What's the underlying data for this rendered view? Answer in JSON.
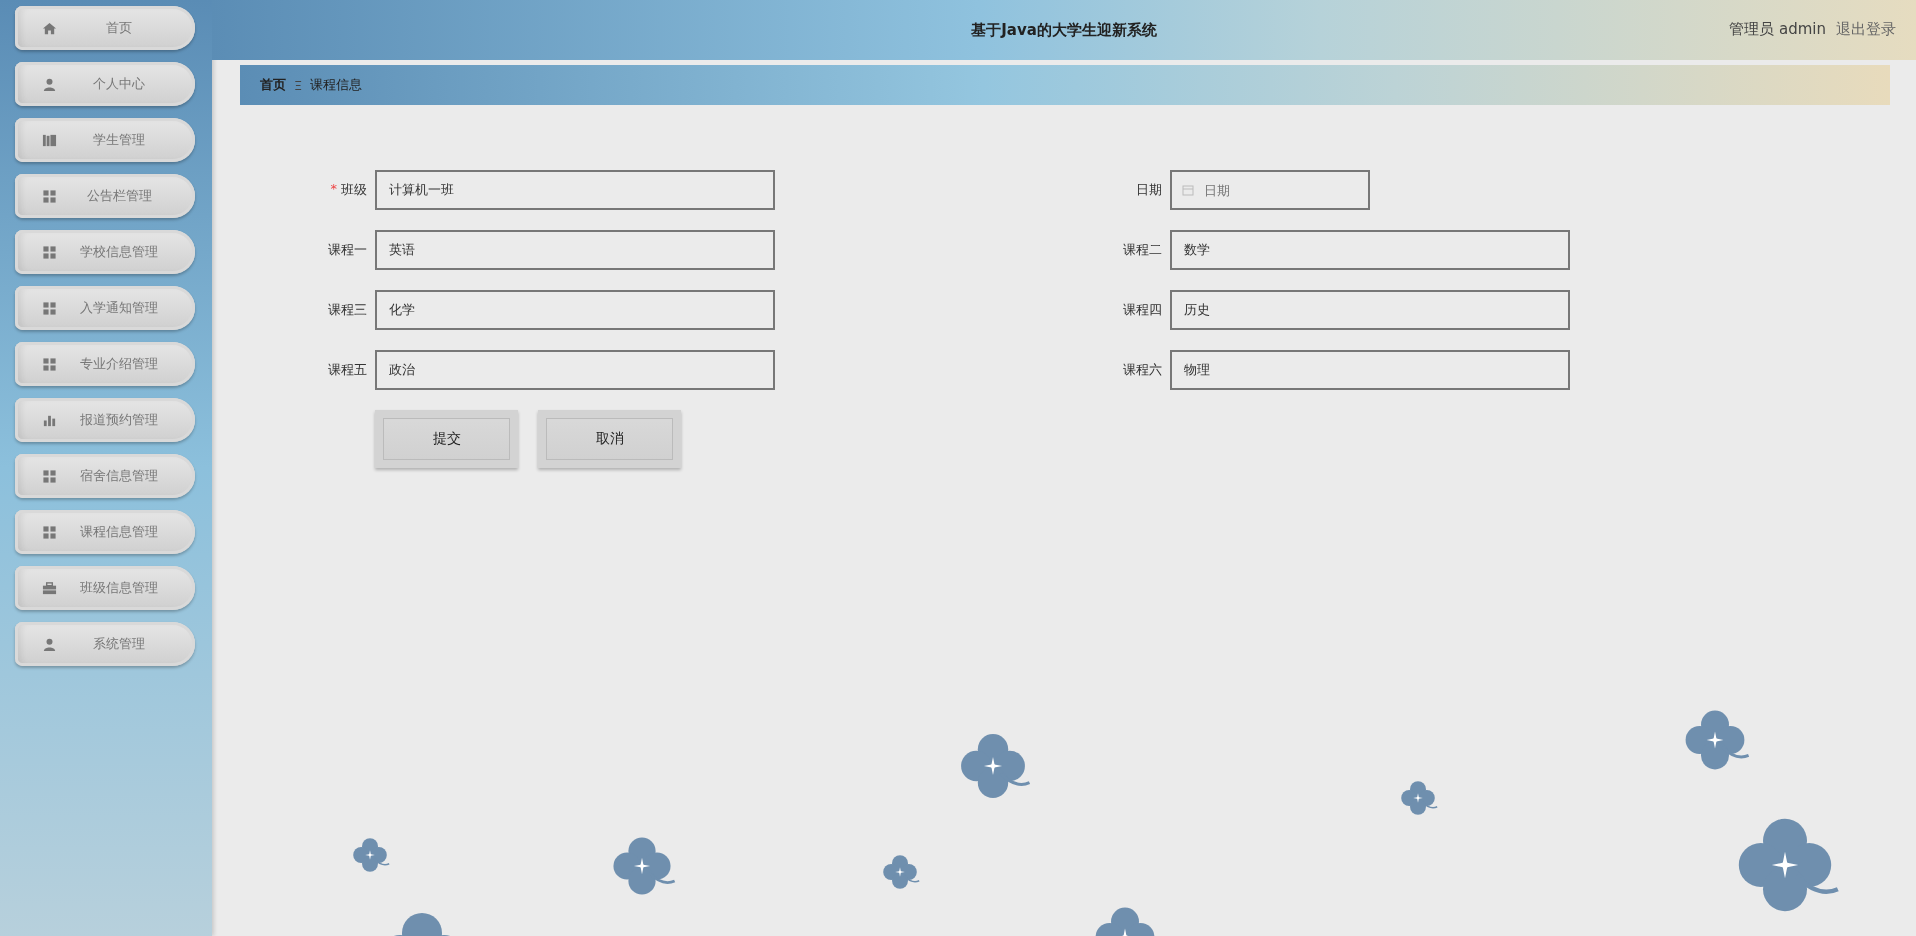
{
  "sidebar": {
    "items": [
      {
        "label": "首页",
        "selected": false
      },
      {
        "label": "个人中心",
        "selected": false
      },
      {
        "label": "学生管理",
        "selected": false
      },
      {
        "label": "公告栏管理",
        "selected": false
      },
      {
        "label": "学校信息管理",
        "selected": false
      },
      {
        "label": "入学通知管理",
        "selected": false
      },
      {
        "label": "专业介绍管理",
        "selected": false
      },
      {
        "label": "报道预约管理",
        "selected": false
      },
      {
        "label": "宿舍信息管理",
        "selected": false
      },
      {
        "label": "课程信息管理",
        "selected": false
      },
      {
        "label": "班级信息管理",
        "selected": false
      },
      {
        "label": "系统管理",
        "selected": false
      }
    ]
  },
  "header": {
    "title": "基于Java的大学生迎新系统",
    "user": "管理员 admin",
    "logout": "退出登录"
  },
  "breadcrumb": {
    "items": [
      "首页",
      "课程信息"
    ],
    "separator": "Ξ"
  },
  "form": {
    "left": [
      {
        "label": "班级",
        "required_mark": "*",
        "value": "计算机一班"
      },
      {
        "label": "课程一",
        "value": "英语"
      },
      {
        "label": "课程三",
        "value": "化学"
      },
      {
        "label": "课程五",
        "value": "政治"
      }
    ],
    "right": [
      {
        "label": "日期",
        "kind": "date",
        "placeholder": "日期"
      },
      {
        "label": "课程二",
        "kind": "text",
        "value": "数学"
      },
      {
        "label": "课程四",
        "kind": "text",
        "value": "历史"
      },
      {
        "label": "课程六",
        "kind": "text",
        "value": "物理"
      }
    ],
    "buttons": [
      "提交",
      "取消"
    ]
  }
}
